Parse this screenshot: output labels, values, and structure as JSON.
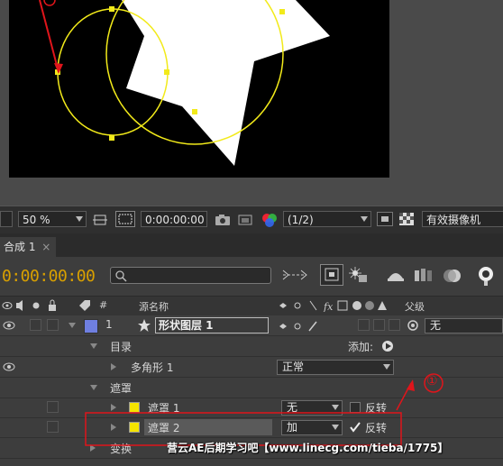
{
  "toolbar": {
    "zoom": "50 %",
    "timecode": "0:00:00:00",
    "resolution": "(1/2)",
    "camera": "有效摄像机"
  },
  "tab": {
    "label": "合成 1",
    "close": "×"
  },
  "timeline": {
    "current_time": "0:00:00:00",
    "search_placeholder": ""
  },
  "header": {
    "num": "#",
    "source_name": "源名称",
    "parent": "父级"
  },
  "layer": {
    "number": "1",
    "name": "形状图层 1",
    "parent_value": "无"
  },
  "rows": {
    "contents": "目录",
    "add_label": "添加:",
    "polygon": "多角形 1",
    "polygon_mode": "正常",
    "masks": "遮罩",
    "mask1": "遮罩 1",
    "mask1_mode": "无",
    "mask1_invert": "反转",
    "mask2": "遮罩 2",
    "mask2_mode": "加",
    "mask2_invert": "反转",
    "transform": "变换"
  },
  "annotation": {
    "marker": "①"
  },
  "watermark": "营云AE后期学习吧【www.linecg.com/tieba/1775】",
  "colors": {
    "timecode": "#d9a000",
    "layer_label": "#6f7fe0",
    "mask_swatch": "#f5e400",
    "annotation": "#e0151b"
  }
}
